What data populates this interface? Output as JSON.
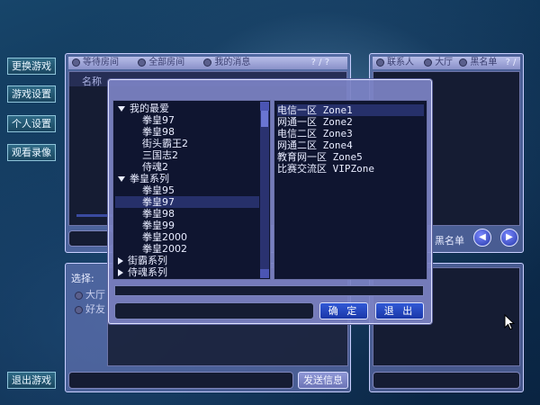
{
  "left_menu": [
    "更换游戏",
    "游戏设置",
    "个人设置",
    "观看录像"
  ],
  "exit_game": "退出游戏",
  "room_tabs": [
    "等待房间",
    "全部房间",
    "我的消息"
  ],
  "room_tabs_right": "? / ?",
  "room_list_header": "名称",
  "right_tabs": [
    "联系人",
    "大厅",
    "黑名单"
  ],
  "right_tabs_right": "? / ?",
  "blacklist_label": "黑名单",
  "chat": {
    "select_label": "选择:",
    "options": [
      "大厅",
      "好友"
    ],
    "send_label": "发送信息"
  },
  "dialog": {
    "tree": [
      {
        "label": "我的最爱",
        "level": 0,
        "expanded": true
      },
      {
        "label": "拳皇97",
        "level": 1
      },
      {
        "label": "拳皇98",
        "level": 1
      },
      {
        "label": "街头霸王2",
        "level": 1
      },
      {
        "label": "三国志2",
        "level": 1
      },
      {
        "label": "侍魂2",
        "level": 1
      },
      {
        "label": "拳皇系列",
        "level": 0,
        "expanded": true
      },
      {
        "label": "拳皇95",
        "level": 1
      },
      {
        "label": "拳皇97",
        "level": 1,
        "selected": true
      },
      {
        "label": "拳皇98",
        "level": 1
      },
      {
        "label": "拳皇99",
        "level": 1
      },
      {
        "label": "拳皇2000",
        "level": 1
      },
      {
        "label": "拳皇2002",
        "level": 1
      },
      {
        "label": "街霸系列",
        "level": 0,
        "expanded": false
      },
      {
        "label": "侍魂系列",
        "level": 0,
        "expanded": false
      }
    ],
    "zones": [
      {
        "label": "电信一区 Zone1",
        "selected": true
      },
      {
        "label": "网通一区 Zone2"
      },
      {
        "label": "电信二区 Zone3"
      },
      {
        "label": "网通二区 Zone4"
      },
      {
        "label": "教育网一区 Zone5"
      },
      {
        "label": "比赛交流区 VIPZone"
      }
    ],
    "ok_label": "确 定",
    "cancel_label": "退 出"
  },
  "colors": {
    "frame": "#7a82c4",
    "panel": "#151c33",
    "button_blue": "#2446c0",
    "menu_button": "#2a5e7a"
  }
}
